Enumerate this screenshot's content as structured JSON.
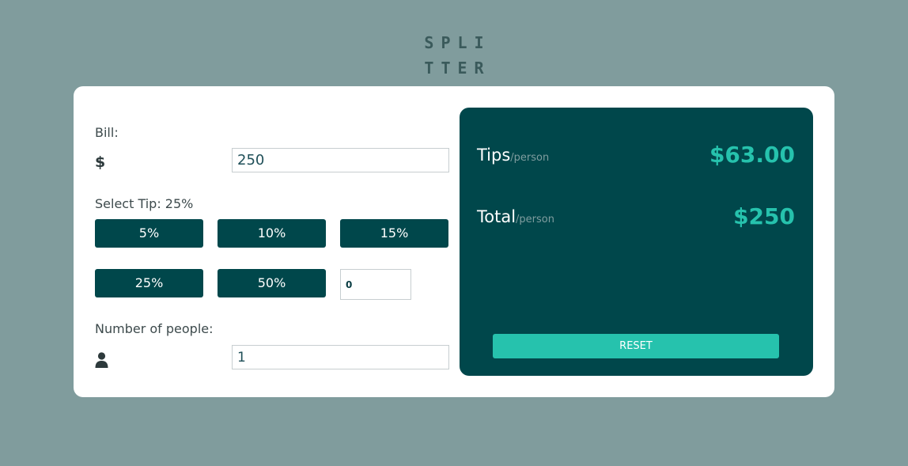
{
  "app": {
    "logo_line1": "SPLI",
    "logo_line2": "TTER"
  },
  "bill": {
    "label": "Bill:",
    "currency_symbol": "$",
    "value": "250"
  },
  "tip": {
    "label": "Select Tip: 25%",
    "options": [
      "5%",
      "10%",
      "15%",
      "25%",
      "50%"
    ],
    "custom_value": "0"
  },
  "people": {
    "label": "Number of people:",
    "icon": "person-icon",
    "value": "1"
  },
  "results": {
    "tip_label": "Tips",
    "tip_suffix": "/person",
    "tip_value": "$63.00",
    "total_label": "Total",
    "total_suffix": "/person",
    "total_value": "$250",
    "reset_label": "RESET"
  },
  "colors": {
    "background": "#809c9d",
    "card": "#ffffff",
    "dark_teal": "#00474b",
    "accent": "#26c2ad",
    "muted_text": "#7f9d9f"
  }
}
